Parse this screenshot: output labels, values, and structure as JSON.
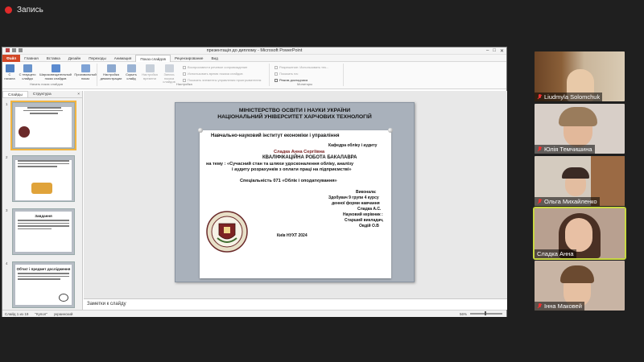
{
  "recording": {
    "label": "Запись"
  },
  "window": {
    "title": "презентація до диплому - Microsoft PowerPoint",
    "controls": {
      "minimize": "–",
      "maximize": "□",
      "close": "✕"
    }
  },
  "ribbon": {
    "tabs": [
      "Файл",
      "Главная",
      "Вставка",
      "Дизайн",
      "Переходы",
      "Анимация",
      "Показ слайдов",
      "Рецензирование",
      "Вид"
    ],
    "active_tab": "Показ слайдов",
    "buttons": {
      "from_start": "С начала",
      "from_current": "С текущего слайда",
      "broadcast": "Широковещательный показ слайдов",
      "custom": "Произвольный показ",
      "setup": "Настройка демонстрации",
      "hide": "Скрыть слайд",
      "rehearse": "Настройка времени",
      "record": "Запись показа слайдов"
    },
    "checks": {
      "narration": "Воспроизвести речевое сопровождение",
      "timings": "Использовать время показа слайдов",
      "media_controls": "Показать элементы управления проигрывателем",
      "resolution": "Разрешение: Использовать тек...",
      "show_on": "Показать на:",
      "presenter_view": "Режим докладчика"
    },
    "groups": {
      "start": "Начать показ слайдов",
      "setup": "Настройка",
      "monitors": "Мониторы"
    }
  },
  "slide_pane": {
    "tabs": [
      "Слайды",
      "Структура"
    ],
    "close": "×",
    "thumbs": [
      {
        "num": "1",
        "title": ""
      },
      {
        "num": "2",
        "title": ""
      },
      {
        "num": "3",
        "title": "Завдання"
      },
      {
        "num": "4",
        "title": "Об'єкт і предмет дослідження"
      }
    ]
  },
  "slide": {
    "ministry_line1": "МІНІСТЕРСТВО ОСВІТИ І НАУКИ УКРАЇНИ",
    "ministry_line2": "НАЦІОНАЛЬНИЙ УНІВЕРСИТЕТ ХАРЧОВИХ ТЕХНОЛОГІЙ",
    "institute": "Навчально-науковий інститут економіки і управління",
    "department": "Кафедра обліку і аудиту",
    "author": "Сладка Анна Сергіївна",
    "work_type": "КВАЛІФІКАЦІЙНА РОБОТА БАКАЛАВРА",
    "topic1": "на тему : «Сучасний стан та шляхи удосконалення обліку, аналізу",
    "topic2": "і аудиту розрахунків з оплати праці на підприємстві»",
    "specialty": "Спеціальність 071 «Облік і оподаткування»",
    "performer": "Виконала:",
    "student1": "Здобувач 9 групи 4 курсу",
    "student2": "денної форми навчання",
    "student3": "Сладка А.С.",
    "supervisor1": "Науковий керівник :",
    "supervisor2": "Старший викладач,",
    "supervisor3": "Овдій О.В",
    "city_year": "Київ НУХТ 2024"
  },
  "notes": {
    "placeholder": "Заметки к слайду"
  },
  "status": {
    "slide_info": "Слайд 1 из 19",
    "theme": "\"Купол\"",
    "language": "украинский",
    "zoom": "56%"
  },
  "participants": [
    {
      "name": "Liudmyla Solomchuk",
      "muted": true
    },
    {
      "name": "Юлія Темчишина",
      "muted": true
    },
    {
      "name": "Ольга Михайленко",
      "muted": true
    },
    {
      "name": "Сладка Анна",
      "muted": false,
      "speaking": true
    },
    {
      "name": "Інна Маковей",
      "muted": true
    }
  ]
}
